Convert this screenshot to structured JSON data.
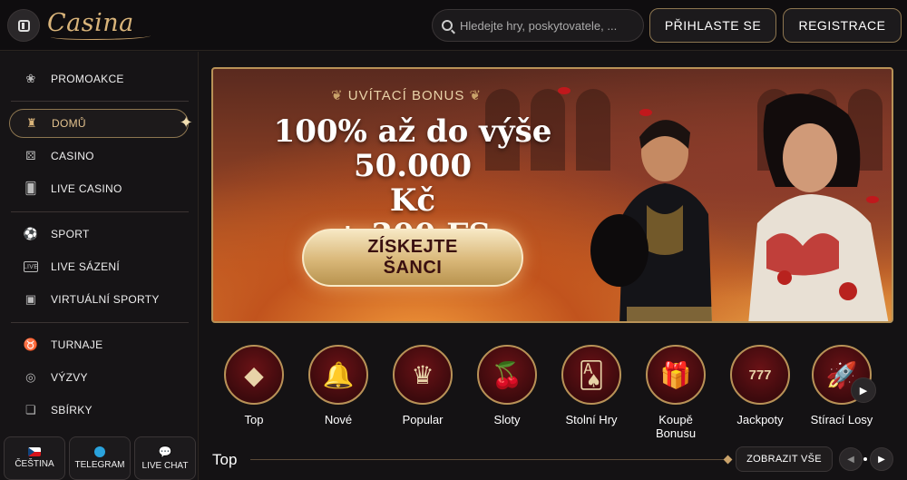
{
  "header": {
    "logo": "Casina",
    "search_placeholder": "Hledejte hry, poskytovatele, ...",
    "login_label": "PŘIHLASTE SE",
    "register_label": "REGISTRACE"
  },
  "sidebar": {
    "items": [
      {
        "label": "PROMOAKCE",
        "icon": "tulip-icon"
      },
      {
        "label": "DOMŮ",
        "icon": "castle-icon"
      },
      {
        "label": "CASINO",
        "icon": "dice-icon"
      },
      {
        "label": "LIVE CASINO",
        "icon": "cards-icon"
      },
      {
        "label": "SPORT",
        "icon": "football-icon"
      },
      {
        "label": "LIVE SÁZENÍ",
        "icon": "live-icon"
      },
      {
        "label": "VIRTUÁLNÍ SPORTY",
        "icon": "monitor-icon"
      },
      {
        "label": "TURNAJE",
        "icon": "bull-icon"
      },
      {
        "label": "VÝZVY",
        "icon": "target-icon"
      },
      {
        "label": "SBÍRKY",
        "icon": "collection-icon"
      }
    ],
    "bottom": {
      "language": "ČEŠTINA",
      "telegram": "TELEGRAM",
      "live_chat": "LIVE CHAT"
    }
  },
  "banner": {
    "bonus_label": "UVÍTACÍ BONUS",
    "title_line1": "100% až do výše 50.000",
    "title_line2": "Kč",
    "title_line3": "+ 300 FS",
    "cta_line1": "ZÍSKEJTE",
    "cta_line2": "ŠANCI"
  },
  "categories": [
    {
      "label": "Top",
      "icon": "diamond-icon",
      "glyph": "◆"
    },
    {
      "label": "Nové",
      "icon": "bell-icon",
      "glyph": "🔔"
    },
    {
      "label": "Popular",
      "icon": "crown-icon",
      "glyph": "♛"
    },
    {
      "label": "Sloty",
      "icon": "cherries-icon",
      "glyph": "🍒"
    },
    {
      "label": "Stolní Hry",
      "icon": "table-games-icon",
      "glyph": "🂡"
    },
    {
      "label": "Koupě Bonusu",
      "icon": "gift-icon",
      "glyph": "🎁"
    },
    {
      "label": "Jackpoty",
      "icon": "jackpot-777-icon",
      "glyph": "777"
    },
    {
      "label": "Stírací Losy",
      "icon": "rocket-icon",
      "glyph": "🚀"
    }
  ],
  "top_section": {
    "title": "Top",
    "show_all": "ZOBRAZIT VŠE"
  }
}
